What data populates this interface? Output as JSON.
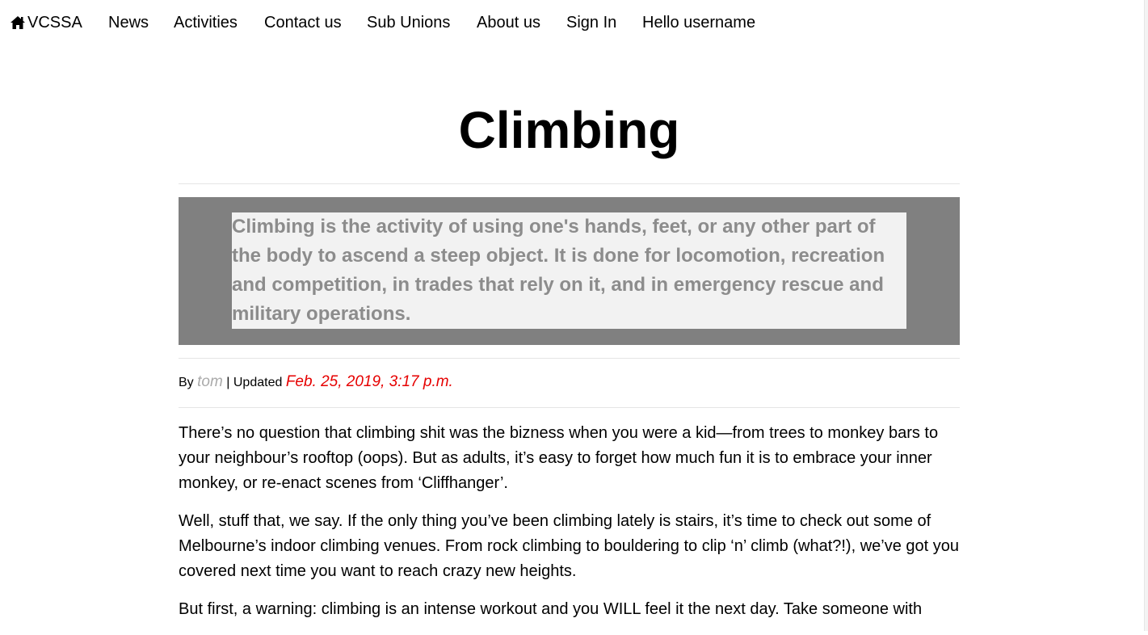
{
  "nav": {
    "brand": "VCSSA",
    "items": [
      "News",
      "Activities",
      "Contact us",
      "Sub Unions",
      "About us",
      "Sign In",
      "Hello username"
    ]
  },
  "article": {
    "title": "Climbing",
    "summary": "Climbing is the activity of using one's hands, feet, or any other part of the body to ascend a steep object. It is done for locomotion, recreation and competition, in trades that rely on it, and in emergency rescue and military operations.",
    "byline": {
      "by_label": "By",
      "author": "tom",
      "separator": "| Updated",
      "date": "Feb. 25, 2019, 3:17 p.m."
    },
    "paragraphs": [
      "There’s no question that climbing shit was the bizness when you were a kid—from trees to monkey bars to your neighbour’s rooftop (oops). But as adults, it’s easy to forget how much fun it is to embrace your inner monkey, or re-enact scenes from ‘Cliffhanger’.",
      "Well, stuff that, we say. If the only thing you’ve been climbing lately is stairs, it’s time to check out some of Melbourne’s indoor climbing venues. From rock climbing to bouldering to clip ‘n’ climb (what?!), we’ve got you covered next time you want to reach crazy new heights.",
      "But first, a warning: climbing is an intense workout and you WILL feel it the next day. Take someone with"
    ]
  },
  "colors": {
    "summary_bg": "#808080",
    "summary_inner_bg": "#f2f2f2",
    "summary_text": "#8c8c8c",
    "date_text": "#e60000",
    "author_text": "#aaaaaa"
  },
  "icons": {
    "brand_icon": "home-icon"
  }
}
